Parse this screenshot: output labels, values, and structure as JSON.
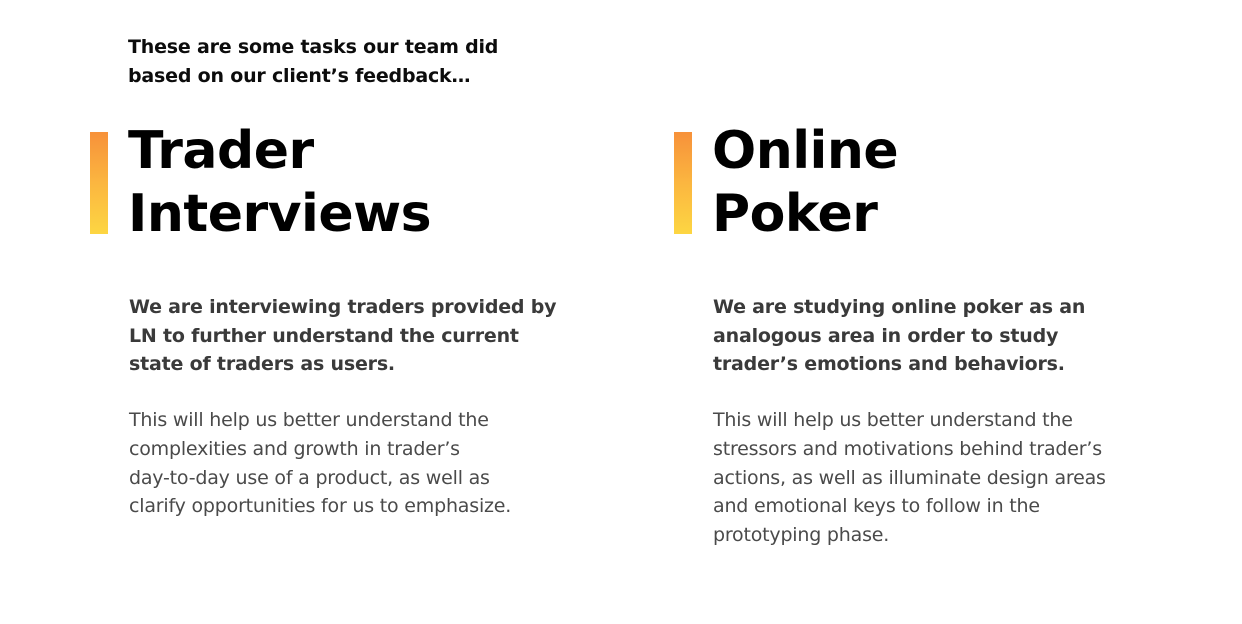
{
  "intro": {
    "lines": [
      "These are some tasks our team did",
      "based on our client’s feedback…"
    ]
  },
  "cards": [
    {
      "title_lines": [
        "Trader",
        "Interviews"
      ],
      "lead_lines": [
        "We are interviewing traders provided by",
        "LN to further understand the current",
        "state of traders as users."
      ],
      "body_lines": [
        "This will help us better understand the",
        "complexities and growth in trader’s",
        "day-to-day use of a product, as well as",
        "clarify opportunities for us to emphasize."
      ]
    },
    {
      "title_lines": [
        "Online",
        "Poker"
      ],
      "lead_lines": [
        "We are studying online poker as an",
        "analogous area in order to study",
        "trader’s emotions and behaviors."
      ],
      "body_lines": [
        "This will help us better understand the",
        "stressors and motivations behind trader’s",
        "actions, as well as illuminate design areas",
        "and emotional keys to follow in the",
        "prototyping phase."
      ]
    }
  ],
  "colors": {
    "accent_top": "#f7913a",
    "accent_bottom": "#fdd642",
    "title": "#000000",
    "lead": "#3a3a3a",
    "body": "#4a4a4a"
  }
}
